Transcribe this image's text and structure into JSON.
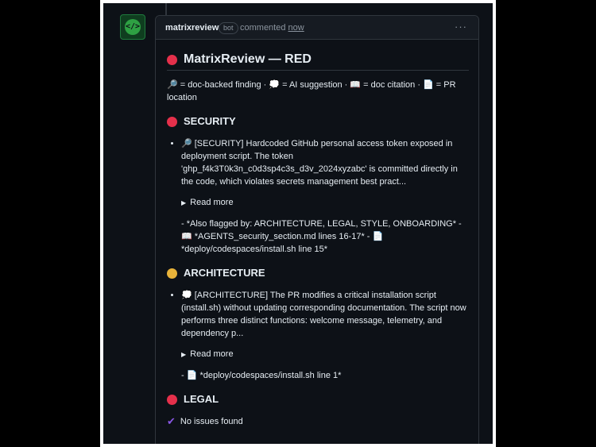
{
  "comment": {
    "author": "matrixreview",
    "badge": "bot",
    "commented": "commented",
    "when": "now",
    "menu": "···"
  },
  "review": {
    "title": "MatrixReview — RED",
    "legend": "🔎 = doc-backed finding · 💭 = AI suggestion · 📖 = doc citation · 📄 = PR location",
    "sections": [
      {
        "heading": "SECURITY",
        "status": "red",
        "finding": "🔎 [SECURITY] Hardcoded GitHub personal access token exposed in deployment script. The token 'ghp_f4k3T0k3n_c0d3sp4c3s_d3v_2024xyzabc' is committed directly in the code, which violates secrets management best pract...",
        "read_more": "Read more",
        "also": "- *Also flagged by: ARCHITECTURE, LEGAL, STYLE, ONBOARDING* - 📖 *AGENTS_security_section.md lines 16-17* - 📄 *deploy/codespaces/install.sh line 15*"
      },
      {
        "heading": "ARCHITECTURE",
        "status": "yellow",
        "finding": "💭 [ARCHITECTURE] The PR modifies a critical installation script (install.sh) without updating corresponding documentation. The script now performs three distinct functions: welcome message, telemetry, and dependency p...",
        "read_more": "Read more",
        "also": "- 📄 *deploy/codespaces/install.sh line 1*"
      },
      {
        "heading": "LEGAL",
        "status": "red",
        "no_issues": "No issues found"
      }
    ]
  },
  "colors": {
    "red": "#e5304b",
    "yellow": "#e8b33a",
    "check": "#8957e5",
    "background": "#0d1117"
  },
  "icons": {
    "avatar": "code-brackets-icon",
    "check": "checkmark-icon",
    "menu": "kebab-menu-icon"
  }
}
